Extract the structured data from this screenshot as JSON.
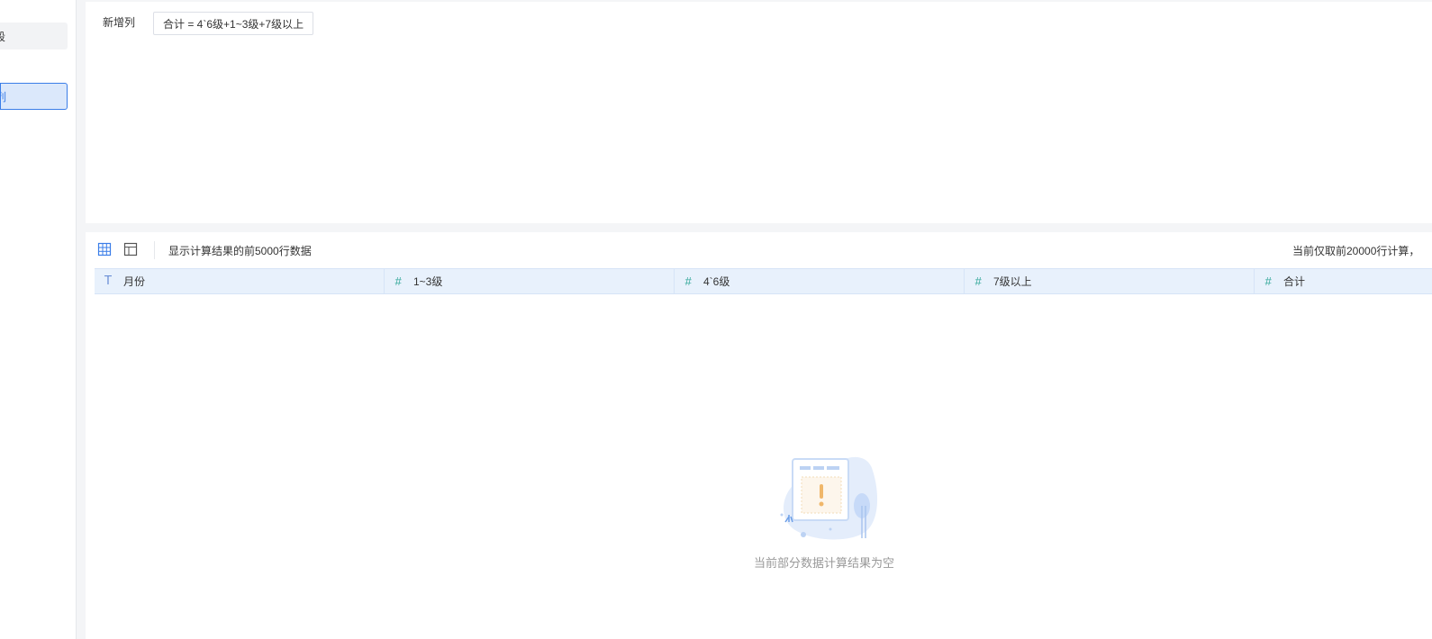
{
  "sidebar": {
    "items": [
      {
        "label": "段"
      },
      {
        "label": "列"
      }
    ]
  },
  "config": {
    "new_column_label": "新增列",
    "formula": "合计 = 4`6级+1~3级+7级以上"
  },
  "preview": {
    "toolbar": {
      "grid_icon": "table-grid-icon",
      "layout_icon": "layout-icon",
      "info_text": "显示计算结果的前5000行数据",
      "right_text": "当前仅取前20000行计算，"
    },
    "columns": [
      {
        "type": "text",
        "icon": "T",
        "label": "月份"
      },
      {
        "type": "number",
        "icon": "#",
        "label": "1~3级"
      },
      {
        "type": "number",
        "icon": "#",
        "label": "4`6级"
      },
      {
        "type": "number",
        "icon": "#",
        "label": "7级以上"
      },
      {
        "type": "number",
        "icon": "#",
        "label": "合计"
      }
    ],
    "empty_message": "当前部分数据计算结果为空"
  },
  "colors": {
    "accent": "#3a7de8",
    "header_bg": "#e8f1fc",
    "number_icon": "#33a89a",
    "text_icon": "#6b8fd6"
  }
}
